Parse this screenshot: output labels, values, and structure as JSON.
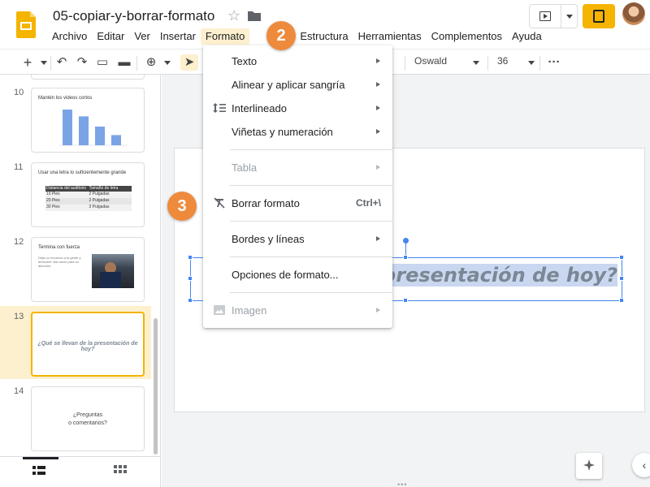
{
  "title": "05-copiar-y-borrar-formato",
  "menubar": [
    "Archivo",
    "Editar",
    "Ver",
    "Insertar",
    "Formato",
    "Diapositiva",
    "Estructura",
    "Herramientas",
    "Complementos",
    "Ayuda"
  ],
  "menubar_visible": [
    "Archivo",
    "Editar",
    "Ver",
    "Insertar",
    "Formato",
    "",
    "iva",
    "Estructura",
    "Herramientas",
    "Complementos",
    "Ayuda"
  ],
  "toolbar": {
    "font": "Oswald",
    "size": "36",
    "more": "···"
  },
  "format_menu": {
    "items": [
      {
        "label": "Texto",
        "submenu": true
      },
      {
        "label": "Alinear y aplicar sangría",
        "submenu": true
      },
      {
        "label": "Interlineado",
        "submenu": true,
        "icon": "line-spacing-icon"
      },
      {
        "label": "Viñetas y numeración",
        "submenu": true
      },
      {
        "label": "Tabla",
        "submenu": true,
        "disabled": true
      },
      {
        "label": "Borrar formato",
        "shortcut": "Ctrl+\\",
        "icon": "clear-format-icon"
      },
      {
        "label": "Bordes y líneas",
        "submenu": true
      },
      {
        "label": "Opciones de formato...",
        "submenu": false
      },
      {
        "label": "Imagen",
        "submenu": true,
        "disabled": true,
        "icon": "image-icon"
      }
    ]
  },
  "badges": {
    "step2": "2",
    "step3": "3"
  },
  "slides": [
    {
      "num": "10",
      "title": "Mantén los videos cortos"
    },
    {
      "num": "11",
      "title": "Usar una letra lo suficientemente grande",
      "table": [
        [
          "Distancia del auditorio",
          "Tamaño de letra"
        ],
        [
          "10 Pies",
          "2 Pulgadas"
        ],
        [
          "20 Pies",
          "2 Pulgadas"
        ],
        [
          "30 Pies",
          "3 Pulgadas"
        ]
      ]
    },
    {
      "num": "12",
      "title": "Termina con fuerza",
      "body": "Deja un recuerdo a la gente y descubre una razón para su atención."
    },
    {
      "num": "13",
      "title": "¿Qué se llevan de la presentación de hoy?"
    },
    {
      "num": "14",
      "title": "¿Preguntas\no comentarios?"
    }
  ],
  "slide_text": "a presentación de hoy?",
  "colors": {
    "accent": "#f4b400",
    "badge": "#ee8a3c",
    "selection": "#4285f4"
  },
  "thumb_chart": {
    "type": "bar",
    "values": [
      42,
      34,
      22,
      12
    ],
    "categories": [
      "",
      "",
      "",
      ""
    ]
  }
}
